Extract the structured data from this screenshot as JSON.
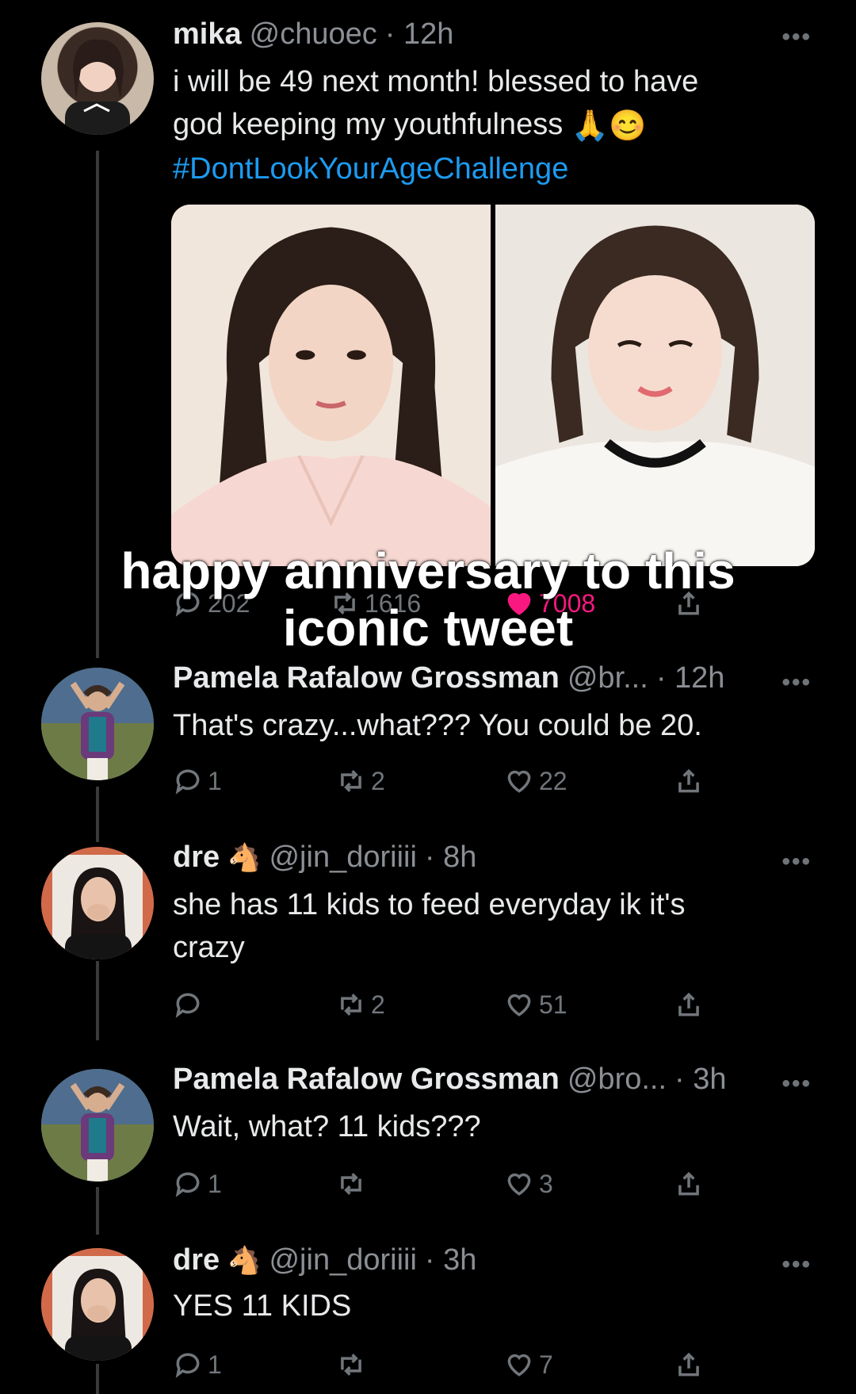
{
  "tweets": [
    {
      "name": "mika",
      "handle": "@chuoec",
      "time": "· 12h",
      "text_line1": "i will be 49 next month! blessed to have",
      "text_line2": "god keeping my youthfulness",
      "emoji": "🙏😊",
      "hashtag": "#DontLookYourAgeChallenge",
      "replies": "202",
      "retweets": "1616",
      "likes": "7008",
      "liked": true
    },
    {
      "name": "Pamela Rafalow Grossman",
      "handle": "@br...",
      "time": "· 12h",
      "text": "That's crazy...what??? You could be 20.",
      "replies": "1",
      "retweets": "2",
      "likes": "22"
    },
    {
      "name": "dre",
      "badge_icon": "horse-icon",
      "handle": "@jin_doriiii",
      "time": "· 8h",
      "text_line1": "she has 11 kids to feed everyday ik it's",
      "text_line2": "crazy",
      "replies": "",
      "retweets": "2",
      "likes": "51"
    },
    {
      "name": "Pamela Rafalow Grossman",
      "handle": "@bro...",
      "time": "· 3h",
      "text": "Wait, what? 11 kids???",
      "replies": "1",
      "retweets": "",
      "likes": "3"
    },
    {
      "name": "dre",
      "badge_icon": "horse-icon",
      "handle": "@jin_doriiii",
      "time": "· 3h",
      "text": "YES 11 KIDS",
      "replies": "1",
      "retweets": "",
      "likes": "7"
    }
  ],
  "overlay_caption": {
    "line1": "happy anniversary to this",
    "line2": "iconic tweet"
  },
  "colors": {
    "background": "#000000",
    "hashtag": "#1d9bf0",
    "like_active": "#f91880",
    "muted": "#71767b"
  }
}
